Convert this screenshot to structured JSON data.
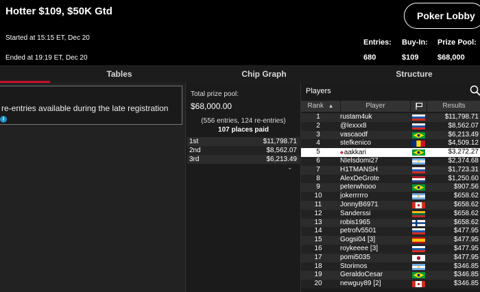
{
  "header": {
    "title": "Hotter $109, $50K Gtd",
    "started": "Started at 15:15 ET, Dec 20",
    "ended": "Ended at 19:19 ET, Dec 20",
    "lobby_button": "Poker Lobby",
    "stats": [
      {
        "label": "Entries:",
        "value": "680"
      },
      {
        "label": "Buy-In:",
        "value": "$109"
      },
      {
        "label": "Prize Pool:",
        "value": "$68,000"
      }
    ]
  },
  "tabs": [
    {
      "label": "Tables",
      "active": true
    },
    {
      "label": "Chip Graph",
      "active": false
    },
    {
      "label": "Structure",
      "active": false
    }
  ],
  "notice": {
    "text": "re-entries available during the late registration",
    "icon": "info-icon"
  },
  "prize": {
    "label": "Total prize pool:",
    "value": "$68,000.00",
    "entries": "(556 entries, 124 re-entries)",
    "paid": "107 places paid",
    "payouts": [
      {
        "place": "1st",
        "amount": "$11,798.71"
      },
      {
        "place": "2nd",
        "amount": "$8,562.07"
      },
      {
        "place": "3rd",
        "amount": "$6,213.49"
      }
    ]
  },
  "players": {
    "title": "Players",
    "columns": {
      "rank": "Rank",
      "player": "Player",
      "results": "Results"
    },
    "rows": [
      {
        "rank": "1",
        "name": "rustam4uk",
        "flag": "ru",
        "result": "$11,798.71"
      },
      {
        "rank": "2",
        "name": "@lexxx8",
        "flag": "ru",
        "result": "$8,562.07"
      },
      {
        "rank": "3",
        "name": "vascaodf",
        "flag": "br",
        "result": "$6,213.49"
      },
      {
        "rank": "4",
        "name": "stefkenico",
        "flag": "ro",
        "result": "$4,509.12"
      },
      {
        "rank": "5",
        "name": "aakkari",
        "flag": "br",
        "result": "$3,272.27",
        "highlight": true,
        "pokerstars_pro": true
      },
      {
        "rank": "6",
        "name": "NIelsdomi27",
        "flag": "ar",
        "result": "$2,374.68"
      },
      {
        "rank": "7",
        "name": "H1TMANSH",
        "flag": "ru",
        "result": "$1,723.31"
      },
      {
        "rank": "8",
        "name": "AlexDeGrote",
        "flag": "nl",
        "result": "$1,250.60"
      },
      {
        "rank": "9",
        "name": "peterwhooo",
        "flag": "br",
        "result": "$907.56"
      },
      {
        "rank": "10",
        "name": "jokerrrrro",
        "flag": "ar",
        "result": "$658.62"
      },
      {
        "rank": "11",
        "name": "JonnyB6971",
        "flag": "ca",
        "result": "$658.62"
      },
      {
        "rank": "12",
        "name": "Sanderssi",
        "flag": "lt",
        "result": "$658.62"
      },
      {
        "rank": "13",
        "name": "robis1965",
        "flag": "fi",
        "result": "$658.62"
      },
      {
        "rank": "14",
        "name": "petrofv5501",
        "flag": "ru",
        "result": "$477.95"
      },
      {
        "rank": "15",
        "name": "Gogsi04 [3]",
        "flag": "es",
        "result": "$477.95"
      },
      {
        "rank": "16",
        "name": "roykeeee [3]",
        "flag": "ru",
        "result": "$477.95"
      },
      {
        "rank": "17",
        "name": "pomi5035",
        "flag": "jp",
        "result": "$477.95"
      },
      {
        "rank": "18",
        "name": "Storimos",
        "flag": "ar",
        "result": "$346.85"
      },
      {
        "rank": "19",
        "name": "GeraldoCesar",
        "flag": "br",
        "result": "$346.85"
      },
      {
        "rank": "20",
        "name": "newguy89 [2]",
        "flag": "ca",
        "result": "$346.85"
      }
    ]
  },
  "colors": {
    "accent": "#c8102e",
    "info": "#1e8fc9"
  }
}
